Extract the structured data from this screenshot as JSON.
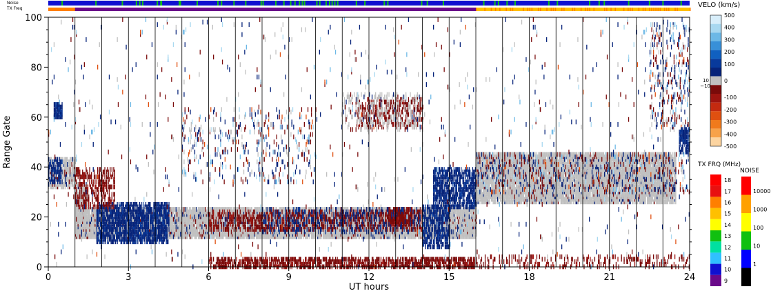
{
  "chart_data": {
    "type": "heatmap",
    "xlabel": "UT hours",
    "ylabel": "Range Gate",
    "xlim": [
      0,
      24
    ],
    "ylim": [
      0,
      100
    ],
    "x_ticks": [
      0,
      3,
      6,
      9,
      12,
      15,
      18,
      21,
      24
    ],
    "y_ticks": [
      0,
      20,
      40,
      60,
      80,
      100
    ],
    "grid": "vertical lines every hour",
    "top_strips": {
      "noise_label": "Noise",
      "txfreq_label": "TX Freq",
      "txfreq_changes_at_hour": 16
    },
    "velocity_scale": {
      "label": "VELO (km/s)",
      "ticks": [
        500,
        400,
        300,
        200,
        100,
        0,
        -100,
        -200,
        -300,
        -400,
        -500
      ],
      "ground_scatter_labels": [
        "10",
        "−10"
      ],
      "positive_colors": [
        "#d8eefa",
        "#a8d8f0",
        "#6cb8e6",
        "#3890d8",
        "#1060c0",
        "#083a9c",
        "#06237a"
      ],
      "negative_colors": [
        "#7a0a0a",
        "#9e1410",
        "#c42a10",
        "#e05010",
        "#f07a1c",
        "#f7a24a",
        "#fcd4a0"
      ],
      "ground_scatter_color": "#c0c0c0"
    },
    "txfreq_scale": {
      "label": "TX FRQ (MHz)",
      "ticks": [
        18,
        17,
        16,
        15,
        14,
        13,
        12,
        11,
        10,
        9
      ],
      "colors": [
        "#ff0000",
        "#e81010",
        "#ff7f00",
        "#ffc000",
        "#ffff00",
        "#10c010",
        "#00e0a0",
        "#30c0ff",
        "#1010d0",
        "#6a0a8a"
      ]
    },
    "noise_scale": {
      "label": "NOISE",
      "ticks": [
        10000,
        1000,
        100,
        10,
        1
      ],
      "colors": [
        "#ff0000",
        "#ffa000",
        "#ffff00",
        "#10c010",
        "#0000ff",
        "#000000"
      ]
    },
    "regions": [
      {
        "name": "ground-scatter-band-early",
        "kind": "ground",
        "x": [
          1.0,
          16.0
        ],
        "y": [
          12,
          24
        ],
        "density": 0.9
      },
      {
        "name": "blue-patch-early",
        "kind": "pos",
        "x": [
          1.8,
          4.5
        ],
        "y": [
          10,
          26
        ],
        "density": 0.65
      },
      {
        "name": "red-patch-mid",
        "kind": "neg",
        "x": [
          6.0,
          14.0
        ],
        "y": [
          15,
          23
        ],
        "density": 0.35
      },
      {
        "name": "red-patch-late",
        "kind": "neg",
        "x": [
          12.7,
          13.6
        ],
        "y": [
          17,
          24
        ],
        "density": 0.8
      },
      {
        "name": "blue-patch-mid",
        "kind": "pos",
        "x": [
          8.0,
          14.0
        ],
        "y": [
          14,
          24
        ],
        "density": 0.15
      },
      {
        "name": "blue-descending",
        "kind": "pos",
        "x": [
          14.0,
          15.0
        ],
        "y": [
          8,
          25
        ],
        "density": 0.55
      },
      {
        "name": "blue-upper-dawn",
        "kind": "pos",
        "x": [
          14.4,
          16.0
        ],
        "y": [
          24,
          40
        ],
        "density": 0.6
      },
      {
        "name": "ground-scatter-band-late",
        "kind": "ground",
        "x": [
          16.0,
          23.5
        ],
        "y": [
          26,
          46
        ],
        "density": 0.85
      },
      {
        "name": "ground-band-start",
        "kind": "ground",
        "x": [
          0.0,
          1.0
        ],
        "y": [
          32,
          44
        ],
        "density": 0.7
      },
      {
        "name": "ground-dip",
        "kind": "ground",
        "x": [
          1.0,
          1.5
        ],
        "y": [
          22,
          34
        ],
        "density": 0.7
      },
      {
        "name": "blue-start",
        "kind": "pos",
        "x": [
          0.0,
          0.5
        ],
        "y": [
          34,
          44
        ],
        "density": 0.5
      },
      {
        "name": "blue-start-high",
        "kind": "pos",
        "x": [
          0.2,
          0.5
        ],
        "y": [
          60,
          66
        ],
        "density": 0.8
      },
      {
        "name": "red-early-upper",
        "kind": "neg",
        "x": [
          1.0,
          2.5
        ],
        "y": [
          24,
          40
        ],
        "density": 0.35
      },
      {
        "name": "red-bottom",
        "kind": "neg",
        "x": [
          6.0,
          16.0
        ],
        "y": [
          0,
          4
        ],
        "density": 0.55
      },
      {
        "name": "red-bottom-late",
        "kind": "neg",
        "x": [
          16.0,
          24.0
        ],
        "y": [
          0,
          5
        ],
        "density": 0.18
      },
      {
        "name": "mixed-mid-high",
        "kind": "mix",
        "x": [
          5.0,
          10.0
        ],
        "y": [
          34,
          64
        ],
        "density": 0.08
      },
      {
        "name": "red-high-cluster",
        "kind": "neg",
        "x": [
          11.5,
          14.0
        ],
        "y": [
          56,
          68
        ],
        "density": 0.28
      },
      {
        "name": "scatter-ground-high",
        "kind": "ground",
        "x": [
          11.0,
          14.0
        ],
        "y": [
          55,
          70
        ],
        "density": 0.2
      },
      {
        "name": "late-high-scatter",
        "kind": "mix",
        "x": [
          22.5,
          24.0
        ],
        "y": [
          56,
          98
        ],
        "density": 0.15
      },
      {
        "name": "blue-end",
        "kind": "pos",
        "x": [
          23.6,
          24.0
        ],
        "y": [
          46,
          56
        ],
        "density": 0.6
      },
      {
        "name": "mixed-late-band",
        "kind": "mix",
        "x": [
          16.0,
          24.0
        ],
        "y": [
          30,
          46
        ],
        "density": 0.12
      },
      {
        "name": "sparse-background",
        "kind": "mix",
        "x": [
          0.0,
          24.0
        ],
        "y": [
          0,
          100
        ],
        "density": 0.012
      }
    ]
  }
}
